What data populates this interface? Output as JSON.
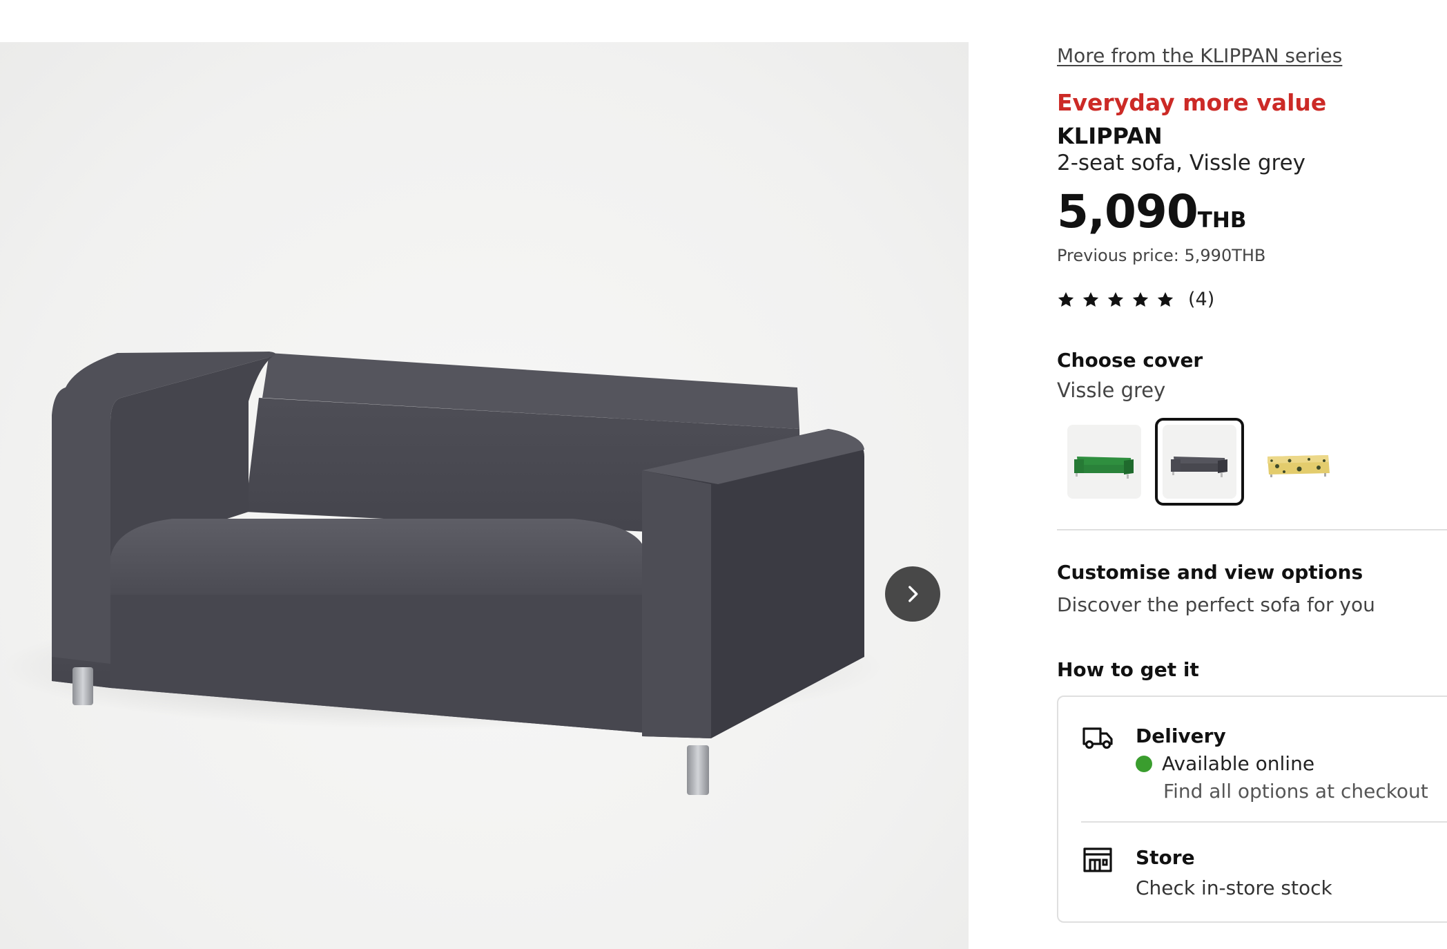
{
  "gallery": {
    "next_icon": "chevron-right-icon"
  },
  "product": {
    "series_link": "More from the KLIPPAN series",
    "tagline": "Everyday more value",
    "name": "KLIPPAN",
    "description": "2-seat sofa, Vissle grey",
    "price": "5,090",
    "currency": "THB",
    "previous_price": "Previous price: 5,990THB",
    "rating": {
      "stars": 5,
      "count": "(4)"
    },
    "colors": {
      "tagline_red": "#cc2a26",
      "available_green": "#3a9d2e"
    }
  },
  "cover": {
    "title": "Choose cover",
    "selected": "Vissle grey",
    "swatches": [
      {
        "color": "green",
        "hex": "#2e8b3e",
        "selected": false
      },
      {
        "color": "grey",
        "hex": "#4a4a52",
        "selected": true
      },
      {
        "color": "yellow patterned",
        "hex": "#e6cf72",
        "selected": false
      }
    ]
  },
  "customise": {
    "title": "Customise and view options",
    "subtitle": "Discover the perfect sofa for you"
  },
  "fulfilment": {
    "title": "How to get it",
    "delivery": {
      "icon": "truck-icon",
      "title": "Delivery",
      "status": "Available online",
      "note": "Find all options at checkout"
    },
    "store": {
      "icon": "store-icon",
      "title": "Store",
      "subtitle": "Check in-store stock"
    }
  }
}
